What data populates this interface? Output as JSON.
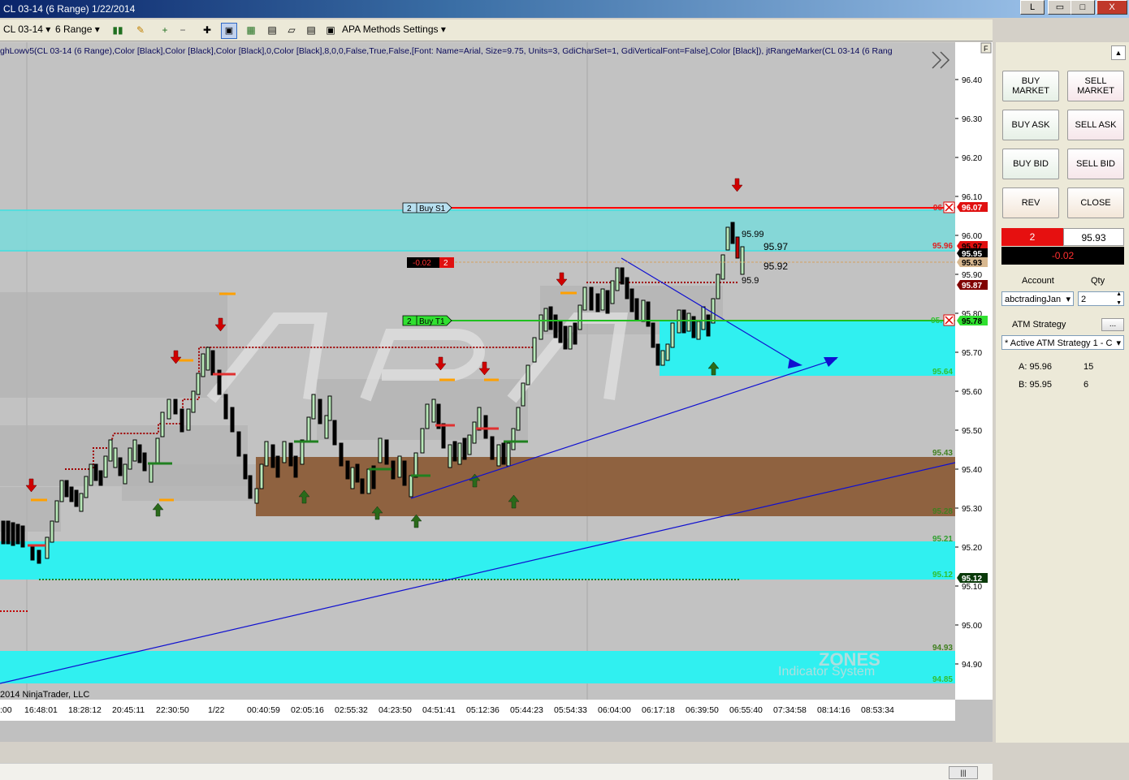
{
  "window": {
    "title": "CL 03-14 (6 Range)  1/22/2014",
    "btn_min": "L",
    "btn_close": "X"
  },
  "toolbar": {
    "instrument": "CL 03-14",
    "period": "6 Range",
    "apa_label": "APA Methods Settings"
  },
  "chart": {
    "indicator_text": "ghLowv5(CL 03-14 (6 Range),Color [Black],Color [Black],Color [Black],0,Color [Black],8,0,0,False,True,False,[Font: Name=Arial, Size=9.75, Units=3, GdiCharSet=1, GdiVerticalFont=False],Color [Black]), jtRangeMarker(CL 03-14 (6 Rang",
    "copyright": "2014 NinjaTrader, LLC",
    "watermark_top": "ZONES",
    "watermark_bottom": "Indicator System",
    "f_button": "F",
    "y_ticks": [
      "96.40",
      "96.30",
      "96.20",
      "96.10",
      "96.00",
      "95.90",
      "95.80",
      "95.70",
      "95.60",
      "95.50",
      "95.40",
      "95.30",
      "95.20",
      "95.10",
      "95.00",
      "94.90"
    ],
    "x_ticks": [
      ":00",
      "16:48:01",
      "18:28:12",
      "20:45:11",
      "22:30:50",
      "1/22",
      "00:40:59",
      "02:05:16",
      "02:55:32",
      "04:23:50",
      "04:51:41",
      "05:12:36",
      "05:44:23",
      "05:54:33",
      "06:04:00",
      "06:17:18",
      "06:39:50",
      "06:55:40",
      "07:34:58",
      "08:14:16",
      "08:53:34"
    ],
    "zone_labels": {
      "z9596": "95.96",
      "z9564": "95.64",
      "z9543": "95.43",
      "z9528": "95.28",
      "z9521": "95.21",
      "z9512": "95.12",
      "z9493": "94.93",
      "z9485": "94.85",
      "z96_partial": "96",
      "z95_partial": "95."
    },
    "price_tags": {
      "p9607": "96.07",
      "p9597": "95.97",
      "p9595": "95.95",
      "p9593": "95.93",
      "p9587": "95.87",
      "p9578": "95.78",
      "p9512": "95.12"
    },
    "annotations": {
      "a9599": "95.99",
      "a9597": "95.97",
      "a9592": "95.92",
      "a959": "95.9"
    },
    "orders": {
      "sell_qty": "2",
      "sell_label": "Buy S1",
      "buy_qty": "2",
      "buy_label": "Buy T1",
      "pnl_value": "-0.02",
      "pnl_qty": "2"
    }
  },
  "panel": {
    "buy_market": "BUY MARKET",
    "sell_market": "SELL MARKET",
    "buy_ask": "BUY ASK",
    "sell_ask": "SELL ASK",
    "buy_bid": "BUY BID",
    "sell_bid": "SELL BID",
    "rev": "REV",
    "close": "CLOSE",
    "position_qty": "2",
    "position_price": "95.93",
    "position_pnl": "-0.02",
    "account_label": "Account",
    "qty_label": "Qty",
    "account_value": "abctradingJan",
    "qty_value": "2",
    "atm_label": "ATM Strategy",
    "atm_btn": "...",
    "atm_value": "* Active ATM Strategy 1 - C",
    "ask_label": "A: 95.96",
    "ask_size": "15",
    "bid_label": "B: 95.95",
    "bid_size": "6"
  }
}
